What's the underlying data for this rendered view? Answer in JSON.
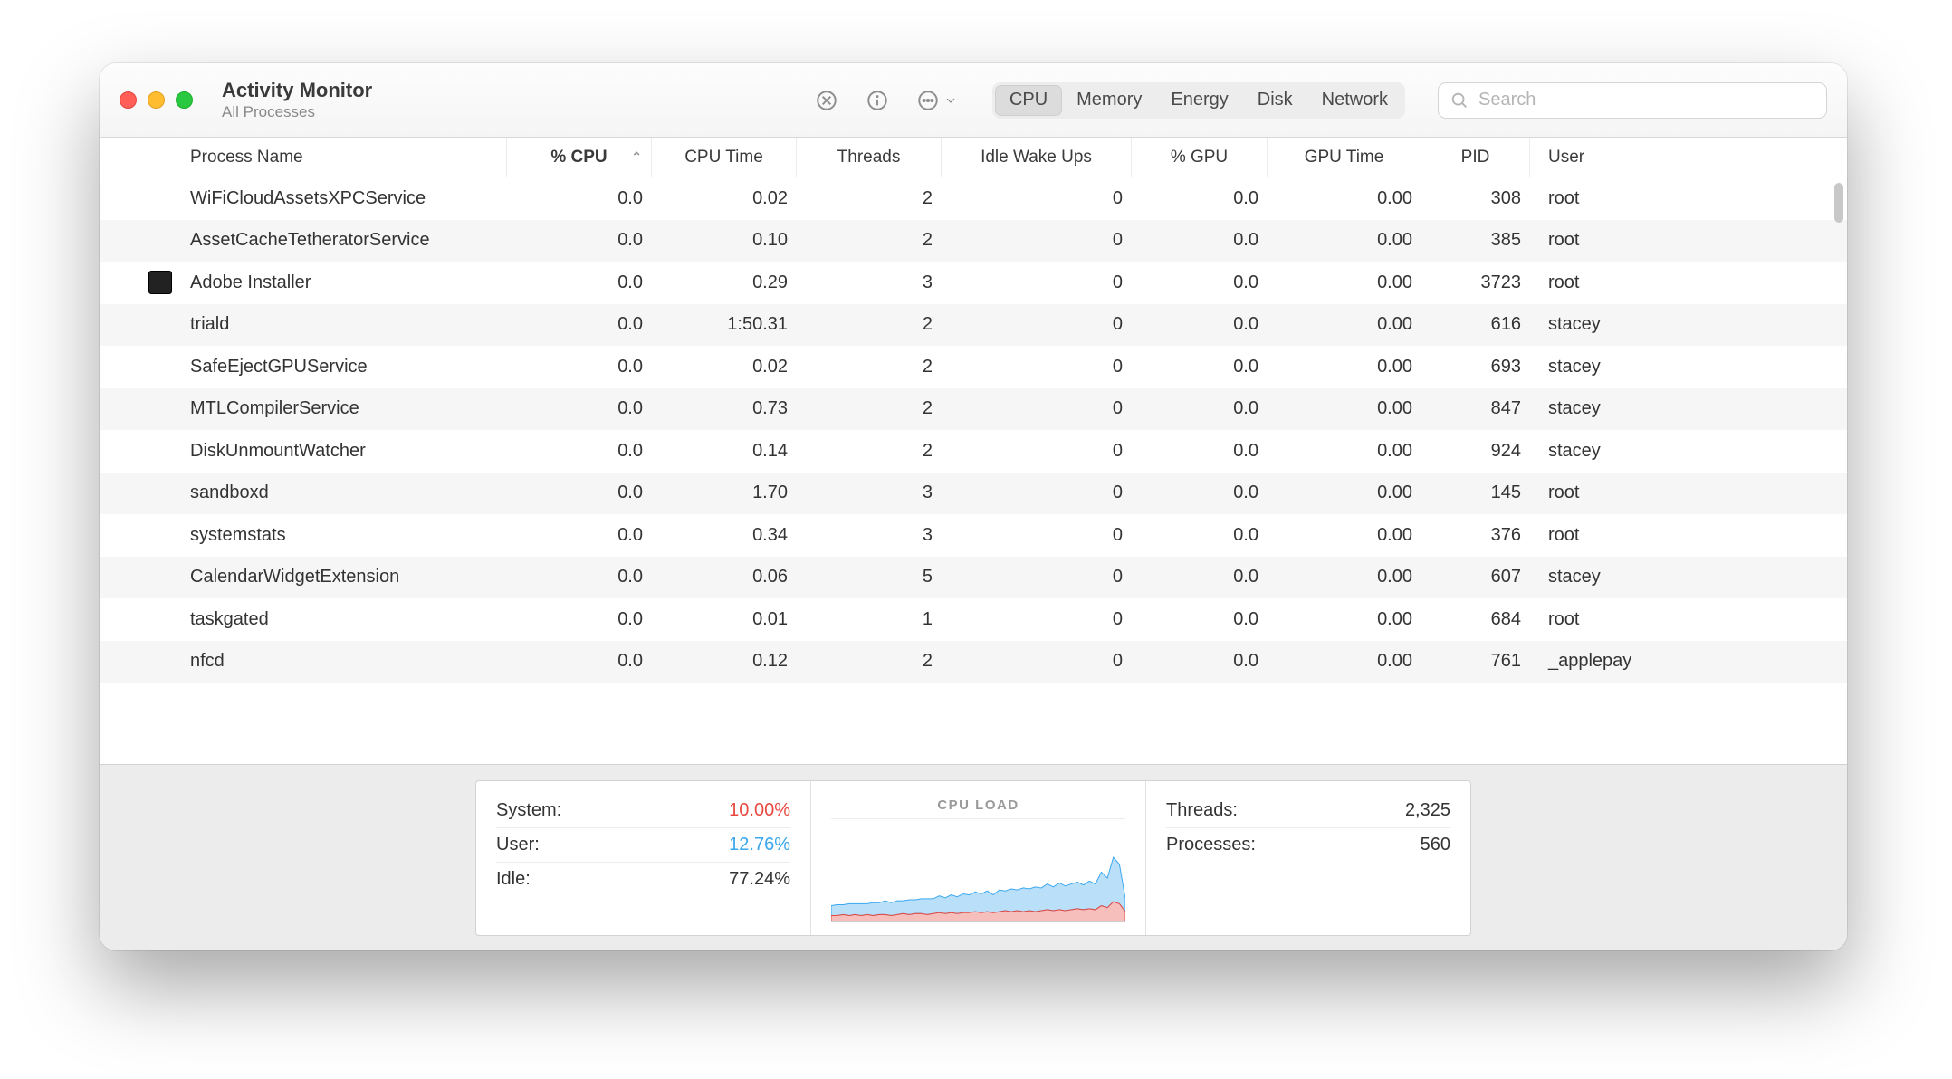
{
  "window": {
    "title": "Activity Monitor",
    "subtitle": "All Processes"
  },
  "tabs": {
    "items": [
      "CPU",
      "Memory",
      "Energy",
      "Disk",
      "Network"
    ],
    "active_index": 0
  },
  "search": {
    "placeholder": "Search"
  },
  "columns": {
    "name": "Process Name",
    "cpu": "% CPU",
    "time": "CPU Time",
    "threads": "Threads",
    "idle": "Idle Wake Ups",
    "gpu": "% GPU",
    "gputime": "GPU Time",
    "pid": "PID",
    "user": "User",
    "sorted": "cpu",
    "sort_dir": "asc"
  },
  "processes": [
    {
      "name": "WiFiCloudAssetsXPCService",
      "cpu": "0.0",
      "time": "0.02",
      "threads": "2",
      "idle": "0",
      "gpu": "0.0",
      "gputime": "0.00",
      "pid": "308",
      "user": "root",
      "icon": false
    },
    {
      "name": "AssetCacheTetheratorService",
      "cpu": "0.0",
      "time": "0.10",
      "threads": "2",
      "idle": "0",
      "gpu": "0.0",
      "gputime": "0.00",
      "pid": "385",
      "user": "root",
      "icon": false
    },
    {
      "name": "Adobe Installer",
      "cpu": "0.0",
      "time": "0.29",
      "threads": "3",
      "idle": "0",
      "gpu": "0.0",
      "gputime": "0.00",
      "pid": "3723",
      "user": "root",
      "icon": true
    },
    {
      "name": "triald",
      "cpu": "0.0",
      "time": "1:50.31",
      "threads": "2",
      "idle": "0",
      "gpu": "0.0",
      "gputime": "0.00",
      "pid": "616",
      "user": "stacey",
      "icon": false
    },
    {
      "name": "SafeEjectGPUService",
      "cpu": "0.0",
      "time": "0.02",
      "threads": "2",
      "idle": "0",
      "gpu": "0.0",
      "gputime": "0.00",
      "pid": "693",
      "user": "stacey",
      "icon": false
    },
    {
      "name": "MTLCompilerService",
      "cpu": "0.0",
      "time": "0.73",
      "threads": "2",
      "idle": "0",
      "gpu": "0.0",
      "gputime": "0.00",
      "pid": "847",
      "user": "stacey",
      "icon": false
    },
    {
      "name": "DiskUnmountWatcher",
      "cpu": "0.0",
      "time": "0.14",
      "threads": "2",
      "idle": "0",
      "gpu": "0.0",
      "gputime": "0.00",
      "pid": "924",
      "user": "stacey",
      "icon": false
    },
    {
      "name": "sandboxd",
      "cpu": "0.0",
      "time": "1.70",
      "threads": "3",
      "idle": "0",
      "gpu": "0.0",
      "gputime": "0.00",
      "pid": "145",
      "user": "root",
      "icon": false
    },
    {
      "name": "systemstats",
      "cpu": "0.0",
      "time": "0.34",
      "threads": "3",
      "idle": "0",
      "gpu": "0.0",
      "gputime": "0.00",
      "pid": "376",
      "user": "root",
      "icon": false
    },
    {
      "name": "CalendarWidgetExtension",
      "cpu": "0.0",
      "time": "0.06",
      "threads": "5",
      "idle": "0",
      "gpu": "0.0",
      "gputime": "0.00",
      "pid": "607",
      "user": "stacey",
      "icon": false
    },
    {
      "name": "taskgated",
      "cpu": "0.0",
      "time": "0.01",
      "threads": "1",
      "idle": "0",
      "gpu": "0.0",
      "gputime": "0.00",
      "pid": "684",
      "user": "root",
      "icon": false
    },
    {
      "name": "nfcd",
      "cpu": "0.0",
      "time": "0.12",
      "threads": "2",
      "idle": "0",
      "gpu": "0.0",
      "gputime": "0.00",
      "pid": "761",
      "user": "_applepay",
      "icon": false
    }
  ],
  "footer": {
    "left": {
      "system_label": "System:",
      "system_value": "10.00%",
      "user_label": "User:",
      "user_value": "12.76%",
      "idle_label": "Idle:",
      "idle_value": "77.24%"
    },
    "chart_title": "CPU LOAD",
    "right": {
      "threads_label": "Threads:",
      "threads_value": "2,325",
      "processes_label": "Processes:",
      "processes_value": "560"
    }
  },
  "chart_data": {
    "type": "area",
    "title": "CPU LOAD",
    "ylim": [
      0,
      100
    ],
    "series": [
      {
        "name": "System",
        "color": "#e8483f",
        "values": [
          6,
          6,
          7,
          6,
          7,
          6,
          7,
          6,
          7,
          7,
          6,
          7,
          8,
          7,
          8,
          8,
          7,
          8,
          9,
          8,
          9,
          8,
          9,
          9,
          10,
          9,
          10,
          9,
          10,
          11,
          10,
          11,
          10,
          11,
          10,
          11,
          12,
          11,
          12,
          11,
          12,
          13,
          12,
          13,
          12,
          16,
          14,
          20,
          18,
          10
        ]
      },
      {
        "name": "User",
        "color": "#3aa7ef",
        "values": [
          10,
          11,
          10,
          12,
          11,
          12,
          11,
          13,
          12,
          14,
          13,
          14,
          13,
          15,
          14,
          15,
          16,
          15,
          17,
          16,
          18,
          17,
          19,
          18,
          20,
          19,
          21,
          18,
          22,
          20,
          23,
          21,
          24,
          22,
          25,
          23,
          26,
          24,
          27,
          25,
          26,
          27,
          25,
          28,
          26,
          34,
          30,
          45,
          40,
          13
        ]
      }
    ]
  }
}
